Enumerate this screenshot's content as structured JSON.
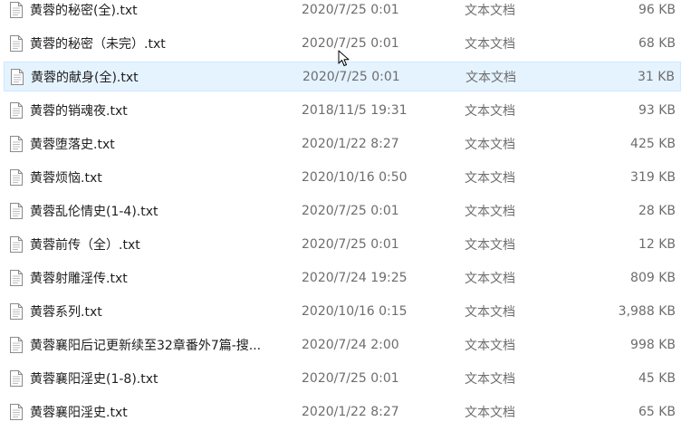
{
  "files": [
    {
      "name": "黄蓉的秘密(全).txt",
      "modified": "2020/7/25 0:01",
      "type": "文本文档",
      "size": "96 KB",
      "icon": "text-file-icon"
    },
    {
      "name": "黄蓉的秘密（未完）.txt",
      "modified": "2020/7/25 0:01",
      "type": "文本文档",
      "size": "68 KB",
      "icon": "text-file-icon"
    },
    {
      "name": "黄蓉的献身(全).txt",
      "modified": "2020/7/25 0:01",
      "type": "文本文档",
      "size": "31 KB",
      "icon": "text-file-icon",
      "selected": true
    },
    {
      "name": "黄蓉的销魂夜.txt",
      "modified": "2018/11/5 19:31",
      "type": "文本文档",
      "size": "93 KB",
      "icon": "text-file-icon"
    },
    {
      "name": "黄蓉堕落史.txt",
      "modified": "2020/1/22 8:27",
      "type": "文本文档",
      "size": "425 KB",
      "icon": "text-file-icon"
    },
    {
      "name": "黄蓉烦恼.txt",
      "modified": "2020/10/16 0:50",
      "type": "文本文档",
      "size": "319 KB",
      "icon": "text-file-icon"
    },
    {
      "name": "黄蓉乱伦情史(1-4).txt",
      "modified": "2020/7/25 0:01",
      "type": "文本文档",
      "size": "28 KB",
      "icon": "text-file-icon"
    },
    {
      "name": "黄蓉前传（全）.txt",
      "modified": "2020/7/25 0:01",
      "type": "文本文档",
      "size": "12 KB",
      "icon": "text-file-icon"
    },
    {
      "name": "黄蓉射雕淫传.txt",
      "modified": "2020/7/24 19:25",
      "type": "文本文档",
      "size": "809 KB",
      "icon": "text-file-icon"
    },
    {
      "name": "黄蓉系列.txt",
      "modified": "2020/10/16 0:15",
      "type": "文本文档",
      "size": "3,988 KB",
      "icon": "text-file-icon"
    },
    {
      "name": "黄蓉襄阳后记更新续至32章番外7篇-搜...",
      "modified": "2020/7/24 2:00",
      "type": "文本文档",
      "size": "998 KB",
      "icon": "text-file-icon"
    },
    {
      "name": "黄蓉襄阳淫史(1-8).txt",
      "modified": "2020/7/25 0:01",
      "type": "文本文档",
      "size": "45 KB",
      "icon": "text-file-icon"
    },
    {
      "name": "黄蓉襄阳淫史.txt",
      "modified": "2020/1/22 8:27",
      "type": "文本文档",
      "size": "65 KB",
      "icon": "text-file-icon"
    }
  ],
  "cursor": {
    "icon": "mouse-pointer-icon"
  },
  "colors": {
    "selection_bg": "#e5f3ff",
    "selection_border": "#cce8ff",
    "secondary_text": "#6d6d6d"
  }
}
